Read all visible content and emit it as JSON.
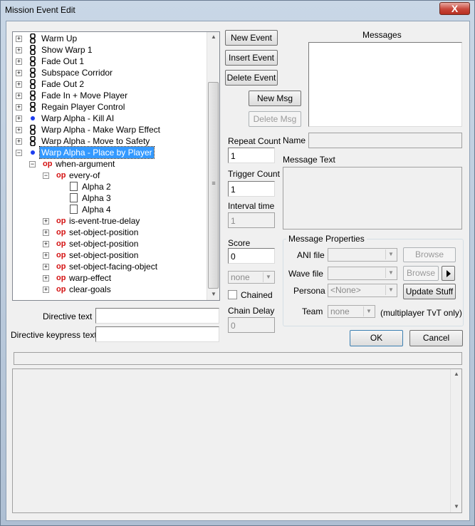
{
  "window": {
    "title": "Mission Event Edit",
    "close_label": "X"
  },
  "tree": {
    "events": [
      {
        "label": "Warm Up",
        "icon": "chain-icon"
      },
      {
        "label": "Show Warp 1",
        "icon": "chain-icon"
      },
      {
        "label": "Fade Out 1",
        "icon": "chain-icon"
      },
      {
        "label": "Subspace Corridor",
        "icon": "chain-icon"
      },
      {
        "label": "Fade Out 2",
        "icon": "chain-icon"
      },
      {
        "label": "Fade In + Move Player",
        "icon": "chain-icon"
      },
      {
        "label": "Regain Player Control",
        "icon": "chain-icon"
      },
      {
        "label": "Warp Alpha - Kill AI",
        "icon": "dot-icon"
      },
      {
        "label": "Warp Alpha - Make Warp Effect",
        "icon": "chain-icon"
      },
      {
        "label": "Warp Alpha - Move to Safety",
        "icon": "chain-icon"
      },
      {
        "label": "Warp Alpha - Place by Player",
        "icon": "dot-icon",
        "selected": true
      }
    ],
    "op_label": "op",
    "when": "when-argument",
    "every_of": "every-of",
    "args": [
      "Alpha 2",
      "Alpha 3",
      "Alpha 4"
    ],
    "ops": [
      "is-event-true-delay",
      "set-object-position",
      "set-object-position",
      "set-object-position",
      "set-object-facing-object",
      "warp-effect",
      "clear-goals"
    ]
  },
  "buttons": {
    "new_event": "New Event",
    "insert_event": "Insert Event",
    "delete_event": "Delete Event",
    "new_msg": "New Msg",
    "delete_msg": "Delete Msg",
    "ok": "OK",
    "cancel": "Cancel",
    "browse_ani": "Browse",
    "browse_wave": "Browse",
    "update_stuff": "Update Stuff"
  },
  "labels": {
    "messages": "Messages",
    "repeat_count": "Repeat Count",
    "trigger_count": "Trigger Count",
    "interval_time": "Interval time",
    "score": "Score",
    "chained": "Chained",
    "chain_delay": "Chain Delay",
    "name": "Name",
    "message_text": "Message Text",
    "message_properties": "Message Properties",
    "ani_file": "ANI file",
    "wave_file": "Wave file",
    "persona": "Persona",
    "team": "Team",
    "team_note": "(multiplayer TvT only)",
    "directive_text": "Directive text",
    "directive_keypress": "Directive keypress text"
  },
  "fields": {
    "repeat_count": "1",
    "trigger_count": "1",
    "interval_time": "1",
    "score": "0",
    "chain_delay": "0",
    "team_combo": "none",
    "persona_combo": "<None>",
    "team_select": "none"
  }
}
